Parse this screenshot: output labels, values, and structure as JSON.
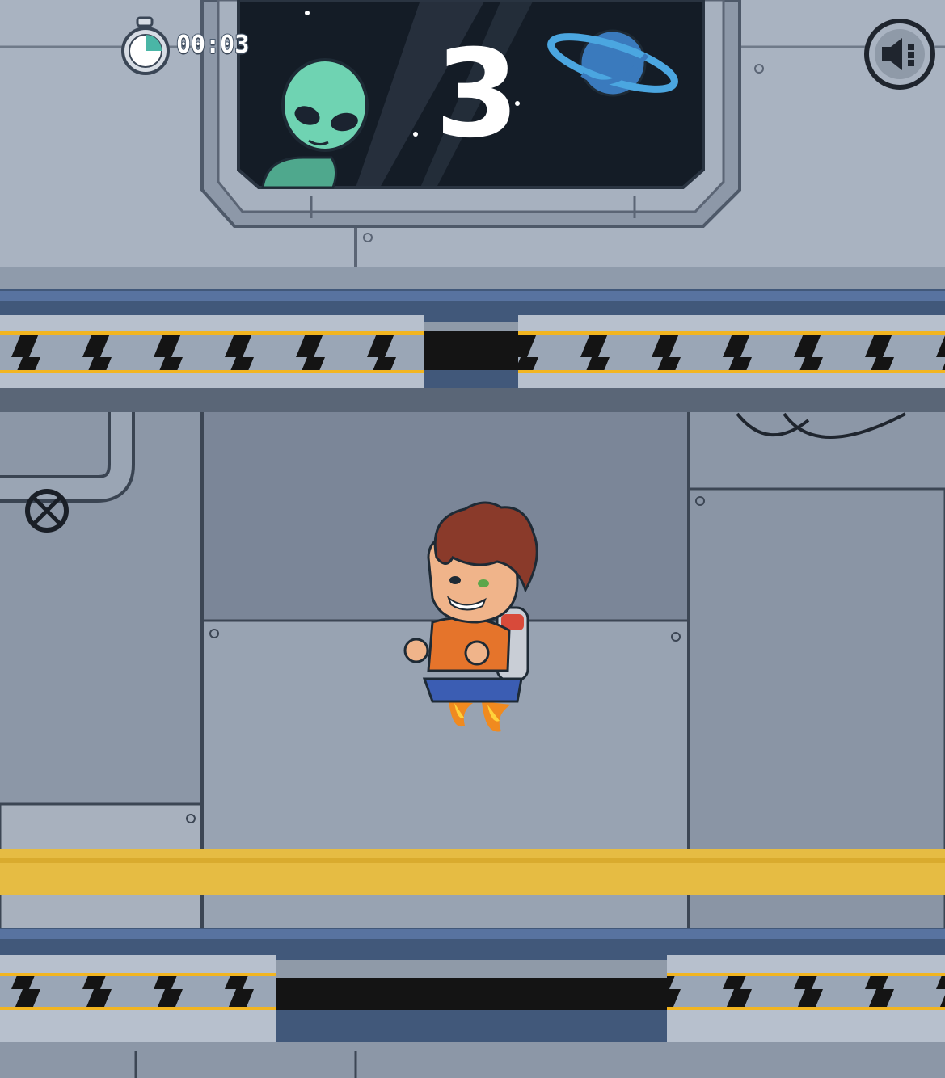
{
  "hud": {
    "timer": "00:03",
    "timer_icon": "stopwatch-icon",
    "score": "3",
    "sound_button_icon": "speaker-icon"
  },
  "colors": {
    "wall_light": "#aab4c2",
    "wall_mid": "#8e99a9",
    "hazard_yellow": "#f2b520",
    "hazard_black": "#141414",
    "rail_blue": "#41587a",
    "window_space": "#141c26",
    "floor_stripe": "#e6bc43"
  },
  "scene": {
    "window_decorations": [
      "alien-icon",
      "planet-icon",
      "star-icon"
    ],
    "player": "jetpack-boy",
    "obstacle": "pipe-valve"
  }
}
